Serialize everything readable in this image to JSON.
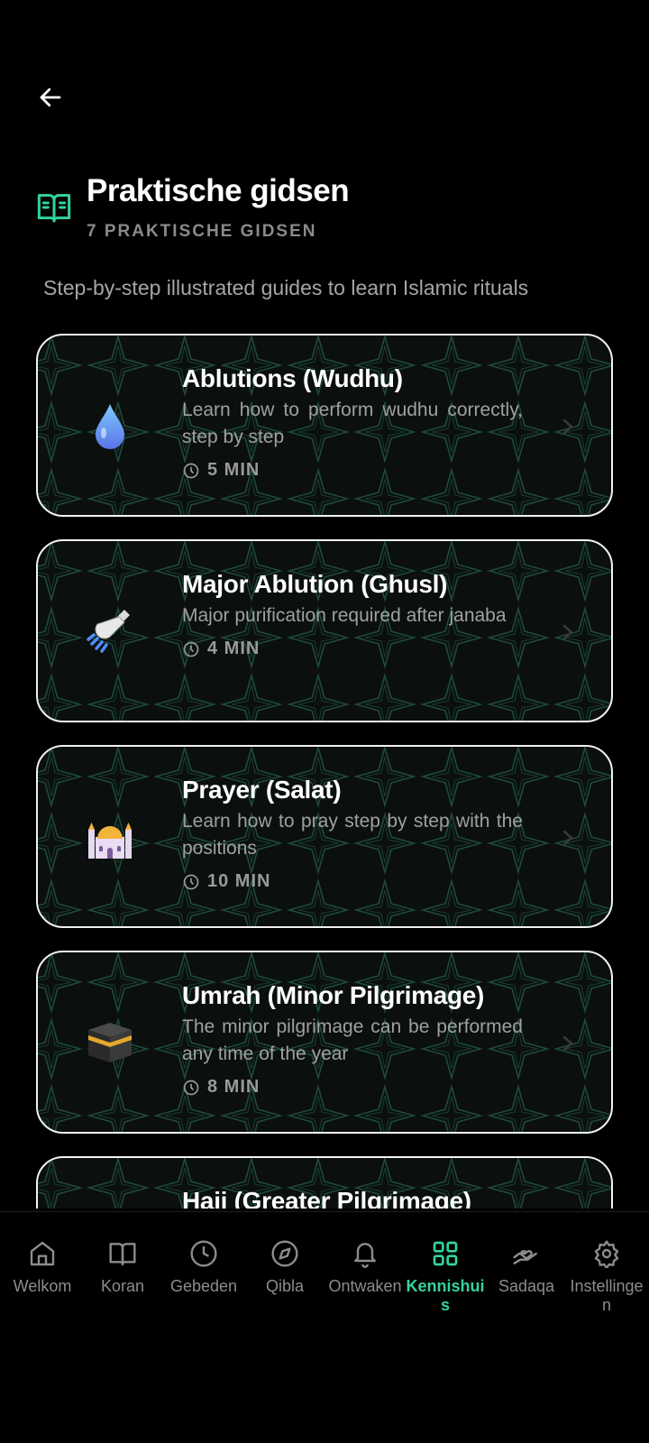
{
  "header": {
    "title": "Praktische gidsen",
    "subtitle": "7 PRAKTISCHE GIDSEN"
  },
  "intro": "Step-by-step illustrated guides to learn Islamic rituals",
  "guides": [
    {
      "title": "Ablutions (Wudhu)",
      "description": "Learn how to perform wudhu correctly, step by step",
      "time": "5 MIN",
      "icon": "water-drop-icon"
    },
    {
      "title": "Major Ablution (Ghusl)",
      "description": "Major purification required after janaba",
      "time": "4 MIN",
      "icon": "shower-icon"
    },
    {
      "title": "Prayer (Salat)",
      "description": "Learn how to pray step by step with the positions",
      "time": "10 MIN",
      "icon": "mosque-icon"
    },
    {
      "title": "Umrah (Minor Pilgrimage)",
      "description": "The minor pilgrimage can be performed any time of the year",
      "time": "8 MIN",
      "icon": "kaaba-icon"
    },
    {
      "title": "Hajj (Greater Pilgrimage)",
      "description": "",
      "time": "",
      "icon": ""
    }
  ],
  "nav": [
    {
      "label": "Welkom",
      "icon": "home-icon"
    },
    {
      "label": "Koran",
      "icon": "book-icon"
    },
    {
      "label": "Gebeden",
      "icon": "clock-icon"
    },
    {
      "label": "Qibla",
      "icon": "compass-icon"
    },
    {
      "label": "Ontwaken",
      "icon": "bell-icon"
    },
    {
      "label": "Kennishuis",
      "icon": "grid-icon",
      "active": true
    },
    {
      "label": "Sadaqa",
      "icon": "hand-heart-icon"
    },
    {
      "label": "Instellingen",
      "icon": "gear-icon"
    }
  ],
  "colors": {
    "accent": "#34d399",
    "background": "#000000",
    "card_border": "#f2f2f2"
  }
}
